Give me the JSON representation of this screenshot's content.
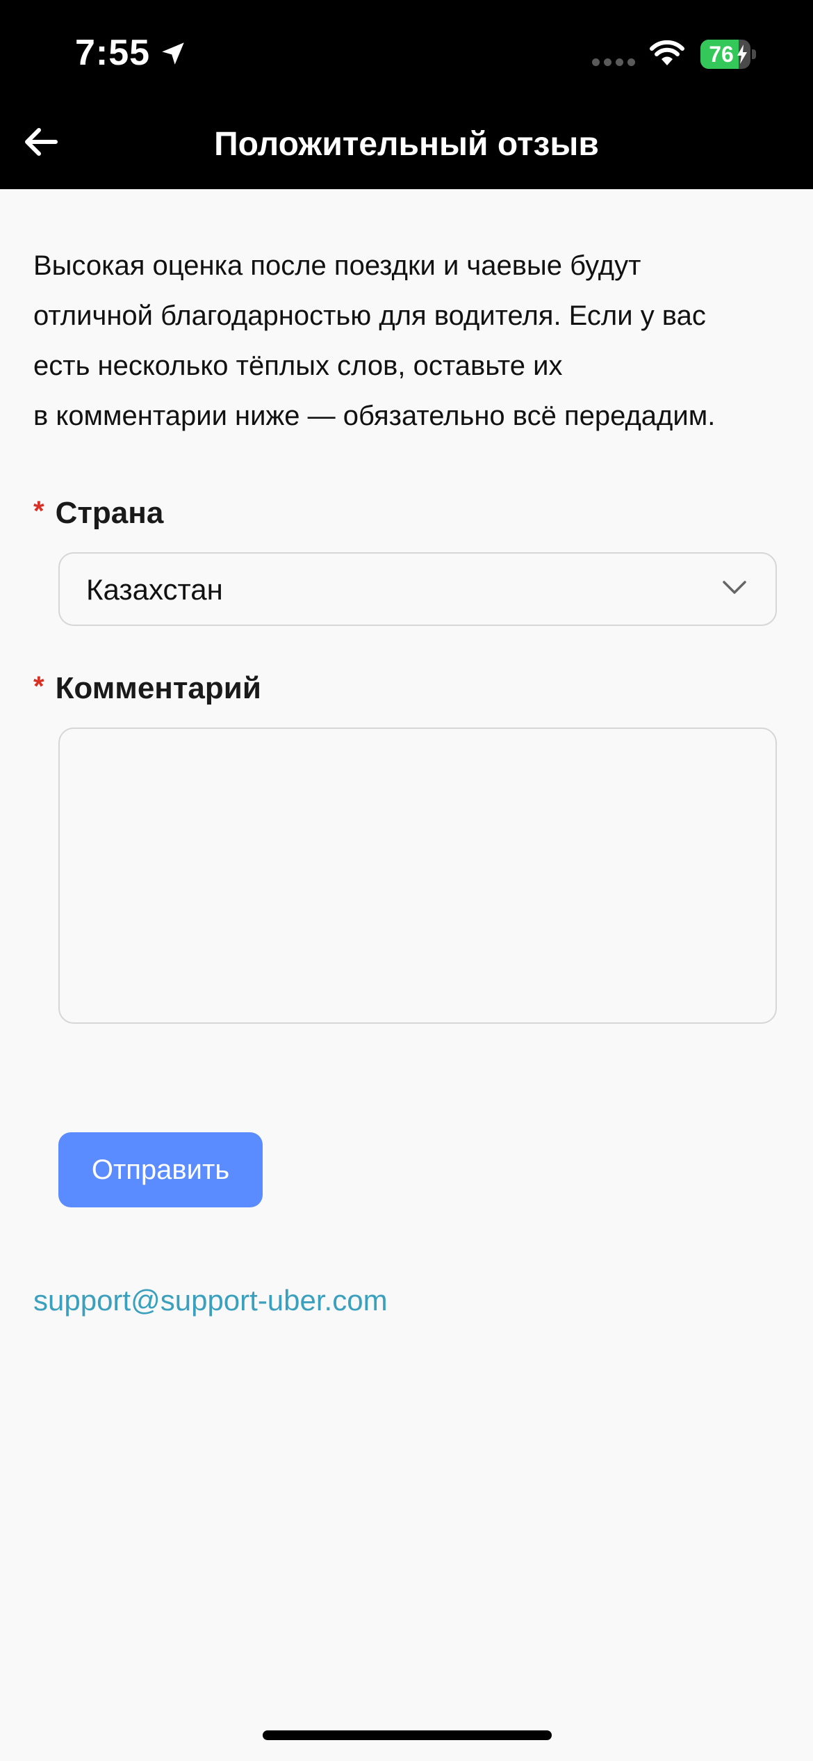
{
  "status_bar": {
    "time": "7:55",
    "battery_percent": "76",
    "battery_level": 0.76,
    "icons": [
      "location-arrow-icon",
      "cellular-signal-icon",
      "wifi-icon",
      "battery-charging-icon"
    ]
  },
  "nav": {
    "title": "Положительный отзыв",
    "back_icon": "arrow-left-icon"
  },
  "intro": {
    "line1": "Высокая оценка после поездки и чаевые будут",
    "line2": "отличной благодарностью для водителя. Если у вас",
    "line3": "есть несколько тёплых слов, оставьте их",
    "line4": "в комментарии ниже — обязательно всё передадим."
  },
  "form": {
    "required_mark": "*",
    "country": {
      "label": "Страна",
      "value": "Казахстан",
      "icon": "chevron-down-icon"
    },
    "comment": {
      "label": "Комментарий",
      "value": ""
    },
    "submit_label": "Отправить"
  },
  "footer": {
    "email": "support@support-uber.com"
  },
  "colors": {
    "accent": "#5b8cff",
    "link": "#3aa0be",
    "required": "#d93025",
    "header_bg": "#000000",
    "page_bg": "#f9f9f9",
    "battery": "#34c759"
  }
}
